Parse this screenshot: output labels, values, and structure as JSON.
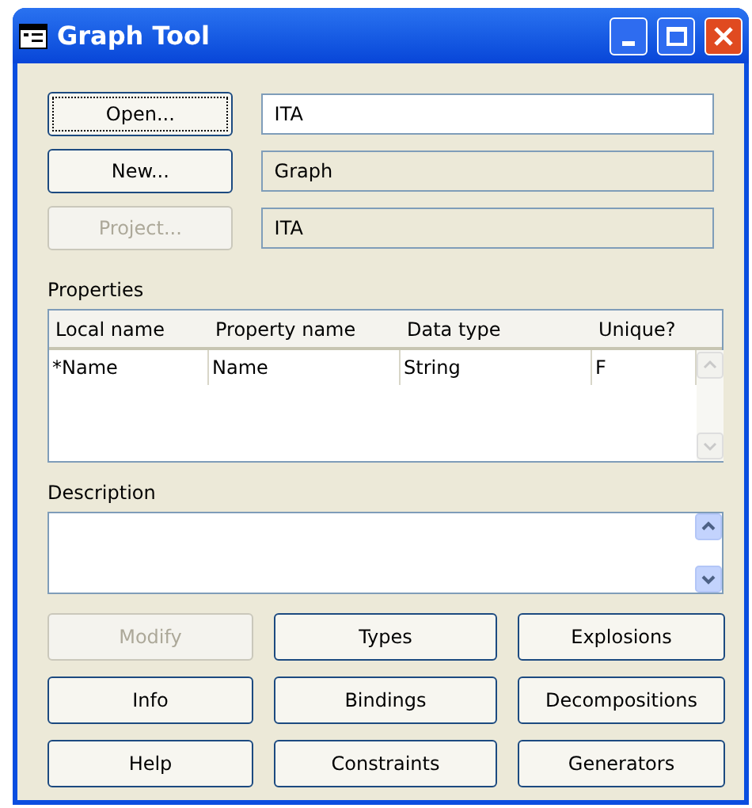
{
  "window": {
    "title": "Graph Tool"
  },
  "file_rows": [
    {
      "button": {
        "label": "Open...",
        "disabled": false,
        "focused": true
      },
      "field": {
        "value": "ITA",
        "editable": true
      }
    },
    {
      "button": {
        "label": "New...",
        "disabled": false,
        "focused": false
      },
      "field": {
        "value": "Graph",
        "editable": false
      }
    },
    {
      "button": {
        "label": "Project...",
        "disabled": true,
        "focused": false
      },
      "field": {
        "value": "ITA",
        "editable": false
      }
    }
  ],
  "properties": {
    "label": "Properties",
    "columns": [
      "Local name",
      "Property name",
      "Data type",
      "Unique?"
    ],
    "rows": [
      [
        "*Name",
        "Name",
        "String",
        "F"
      ]
    ]
  },
  "description": {
    "label": "Description"
  },
  "buttons": [
    {
      "label": "Modify",
      "disabled": true
    },
    {
      "label": "Types",
      "disabled": false
    },
    {
      "label": "Explosions",
      "disabled": false
    },
    {
      "label": "Info",
      "disabled": false
    },
    {
      "label": "Bindings",
      "disabled": false
    },
    {
      "label": "Decompositions",
      "disabled": false
    },
    {
      "label": "Help",
      "disabled": false
    },
    {
      "label": "Constraints",
      "disabled": false
    },
    {
      "label": "Generators",
      "disabled": false
    }
  ]
}
